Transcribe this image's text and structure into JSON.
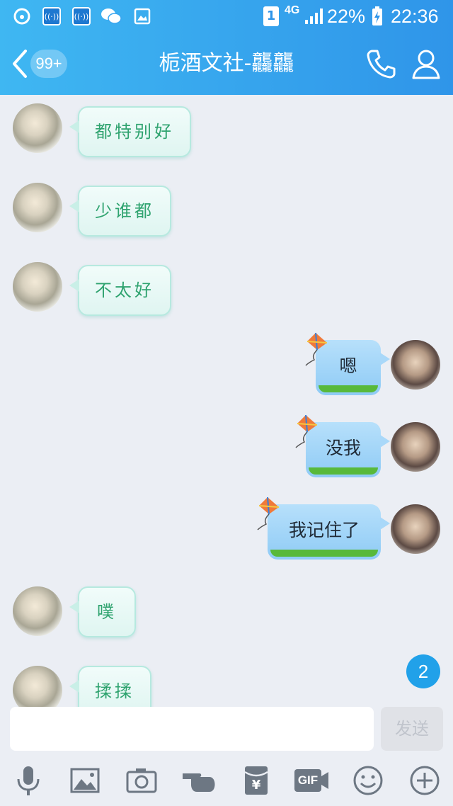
{
  "status_bar": {
    "sim_slot": "1",
    "network": "4G",
    "battery_percent": "22%",
    "time": "22:36",
    "icons": [
      "netease-music-icon",
      "wifi-hotspot-icon",
      "wifi-hotspot-icon",
      "wechat-icon",
      "gallery-icon",
      "signal-icon",
      "battery-charging-icon"
    ]
  },
  "header": {
    "unread_badge": "99+",
    "title": "栀酒文社-龘龘",
    "icons": [
      "back-chevron-icon",
      "phone-icon",
      "profile-icon"
    ]
  },
  "messages": [
    {
      "side": "left",
      "text": "都特别好"
    },
    {
      "side": "left",
      "text": "少谁都"
    },
    {
      "side": "left",
      "text": "不太好"
    },
    {
      "side": "right",
      "text": "嗯"
    },
    {
      "side": "right",
      "text": "没我"
    },
    {
      "side": "right",
      "text": "我记住了"
    },
    {
      "side": "left",
      "text": "噗"
    },
    {
      "side": "left",
      "text": "揉揉"
    }
  ],
  "new_message_count": "2",
  "composer": {
    "input_value": "",
    "send_label": "发送"
  },
  "toolbar": {
    "icons": [
      "microphone-icon",
      "image-icon",
      "camera-icon",
      "poke-hand-icon",
      "red-packet-icon",
      "gif-icon",
      "emoji-icon",
      "plus-icon"
    ],
    "gif_label": "GIF",
    "red_packet_label": "¥"
  },
  "colors": {
    "header_blue": "#2f95e9",
    "accent_blue": "#21a1e9",
    "left_text_green": "#2fa36f",
    "right_bubble_blue": "#9fd2f7"
  }
}
